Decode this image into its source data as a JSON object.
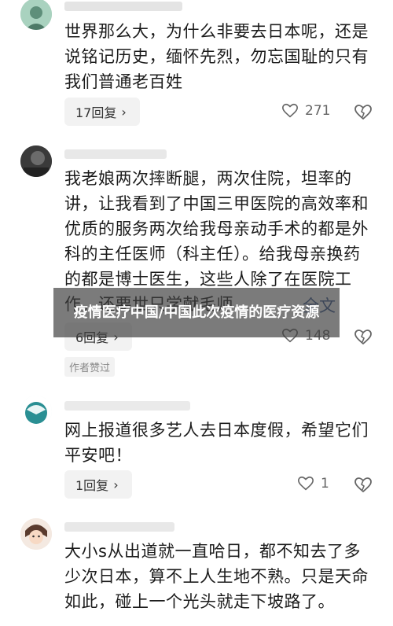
{
  "comments": [
    {
      "text": "世界那么大，为什么非要去日本呢，还是说铭记历史，缅怀先烈，勿忘国耻的只有我们普通老百姓",
      "reply_label": "17回复",
      "like_count": "271"
    },
    {
      "text": "我老娘两次摔断腿，两次住院，坦率的讲，让我看到了中国三甲医院的高效率和优质的服务两次给我母亲动手术的都是外科的主任医师（科主任）。给我母亲换药的都是博士医生，这些人除了在医院工作，还要世只学献毛师...",
      "full_text_label": "全文",
      "reply_label": "6回复",
      "like_count": "148",
      "badge": "作者赞过"
    },
    {
      "text": "网上报道很多艺人去日本度假，希望它们平安吧！",
      "reply_label": "1回复",
      "like_count": "1"
    },
    {
      "text": "大小s从出道就一直哈日，都不知去了多少次日本，算不上人生地不熟。只是天命如此，碰上一个光头就走下坡路了。"
    }
  ],
  "overlay_title": "疫情医疗中国/中国此次疫情的医疗资源",
  "colors": {
    "background": "#ffffff",
    "pill": "#f2f2f2",
    "link": "#3b5b92",
    "muted": "#666666"
  },
  "icons": {
    "like": "heart-outline-icon",
    "dislike": "broken-heart-icon",
    "reply_more": "chevron-right-icon"
  }
}
